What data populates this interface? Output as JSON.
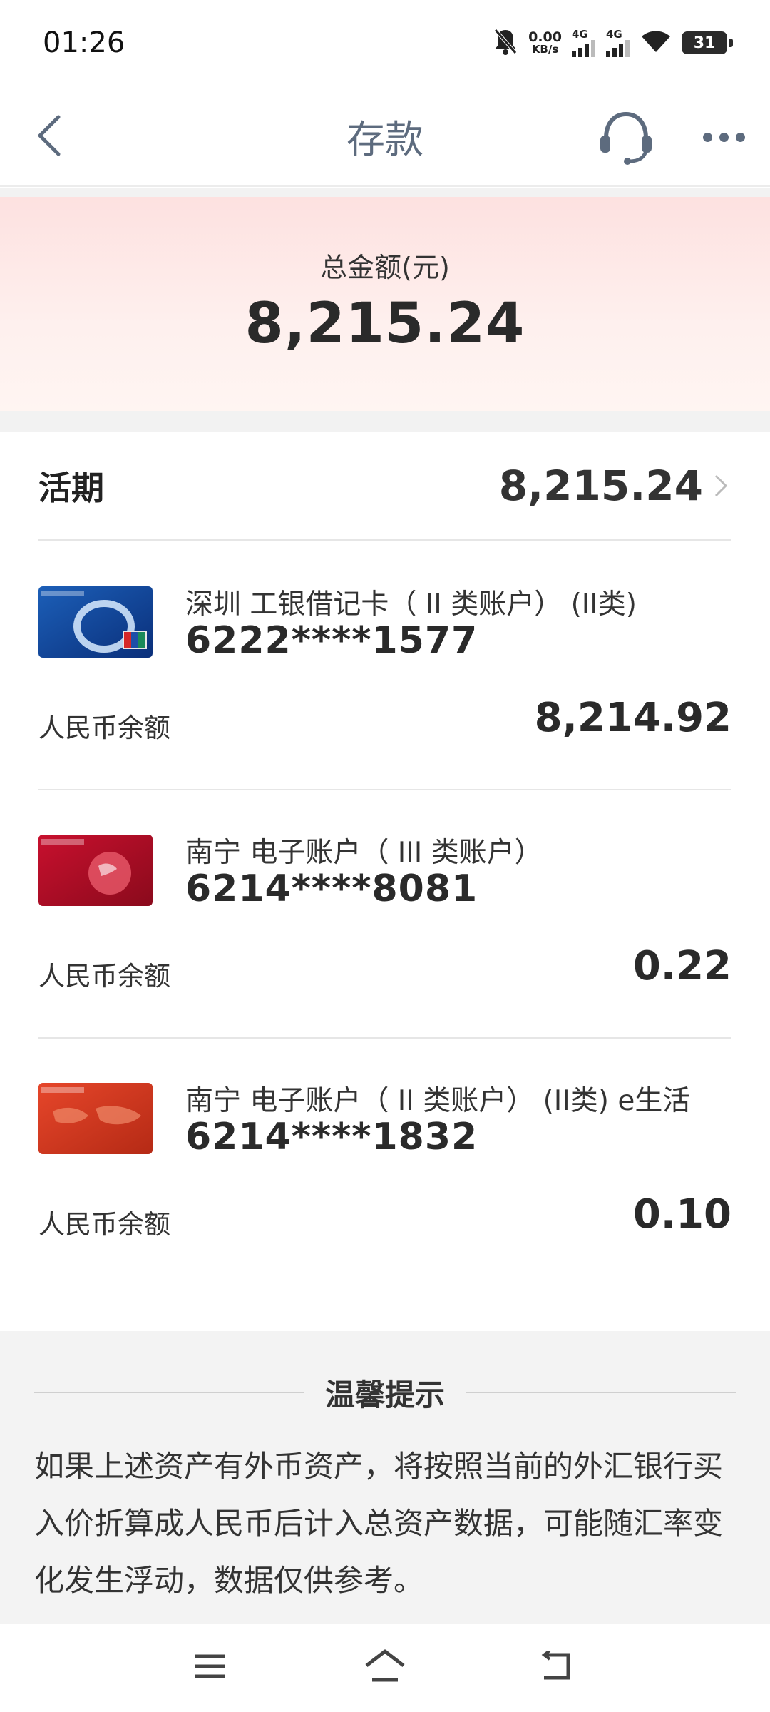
{
  "status_bar": {
    "time": "01:26",
    "net_speed_value": "0.00",
    "net_speed_unit": "KB/s",
    "signal1_label": "4G",
    "signal2_label": "4G",
    "battery": "31",
    "icons": [
      "mute-bell-icon",
      "signal-icon",
      "signal-icon",
      "wifi-icon",
      "battery-icon"
    ]
  },
  "nav": {
    "title": "存款",
    "icons": [
      "back-arrow-icon",
      "headset-icon",
      "more-icon"
    ]
  },
  "summary": {
    "label": "总金额(元)",
    "amount": "8,215.24"
  },
  "current": {
    "label": "活期",
    "amount": "8,215.24"
  },
  "accounts": [
    {
      "name": "深圳 工银借记卡（ II 类账户） (II类)",
      "number": "6222****1577",
      "balance_label": "人民币余额",
      "balance": "8,214.92",
      "card_icon": "icbc-e-card-icon"
    },
    {
      "name": "南宁 电子账户（ III 类账户）",
      "number": "6214****8081",
      "balance_label": "人民币余额",
      "balance": "0.22",
      "card_icon": "icbc-red-card-icon"
    },
    {
      "name": "南宁 电子账户（ II 类账户） (II类) e生活",
      "number": "6214****1832",
      "balance_label": "人民币余额",
      "balance": "0.10",
      "card_icon": "icbc-orange-card-icon"
    }
  ],
  "tips": {
    "title": "温馨提示",
    "text": "如果上述资产有外币资产，将按照当前的外汇银行买入价折算成人民币后计入总资产数据，可能随汇率变化发生浮动，数据仅供参考。"
  },
  "system_nav": {
    "icons": [
      "menu-icon",
      "home-icon",
      "back-icon"
    ]
  },
  "colors": {
    "nav_text": "#5d6b7e",
    "banner_pink": "#fde1e0",
    "tips_bg": "#f3f3f3"
  }
}
